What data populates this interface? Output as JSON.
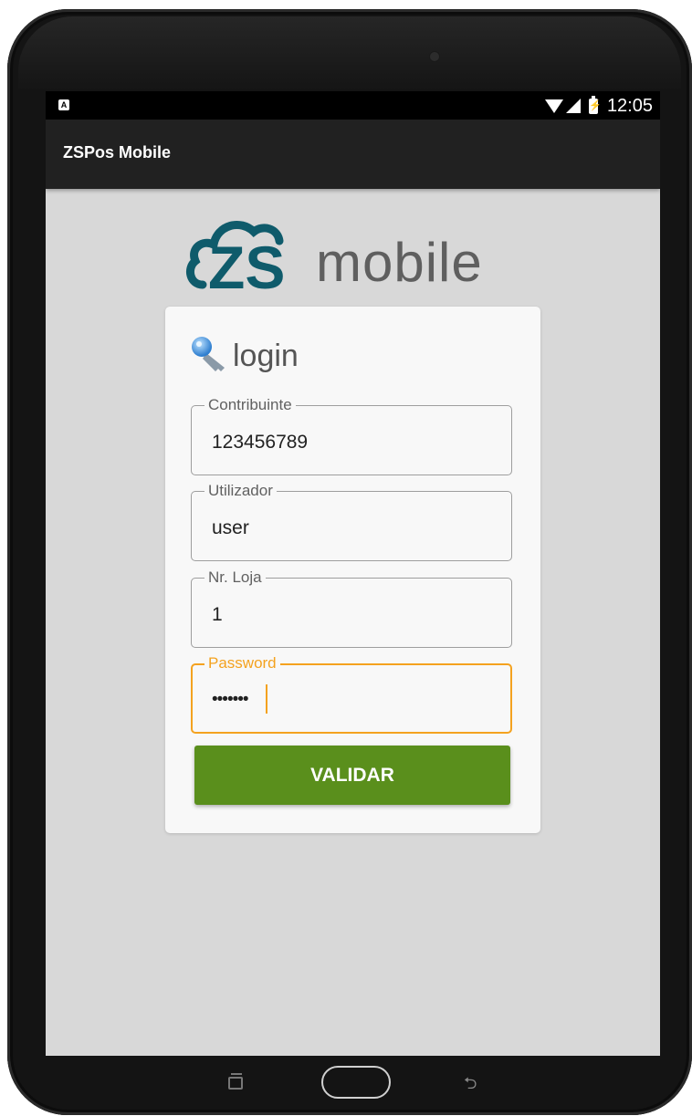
{
  "status_bar": {
    "notification_icon": "android-notification-icon",
    "time": "12:05"
  },
  "app_bar": {
    "title": "ZSPos Mobile"
  },
  "logo": {
    "mark": "ZS",
    "text": "mobile"
  },
  "login": {
    "title": "login",
    "fields": [
      {
        "label": "Contribuinte",
        "value": "123456789"
      },
      {
        "label": "Utilizador",
        "value": "user"
      },
      {
        "label": "Nr. Loja",
        "value": "1"
      },
      {
        "label": "Password",
        "value": "•••••••"
      }
    ],
    "submit_label": "VALIDAR"
  },
  "colors": {
    "accent_focus": "#f4a21f",
    "button_green": "#5a8f1c",
    "logo_teal": "#0f5b6b",
    "app_bar": "#212121"
  },
  "nav_icons": [
    "recent-apps-icon",
    "home-icon",
    "back-icon"
  ]
}
